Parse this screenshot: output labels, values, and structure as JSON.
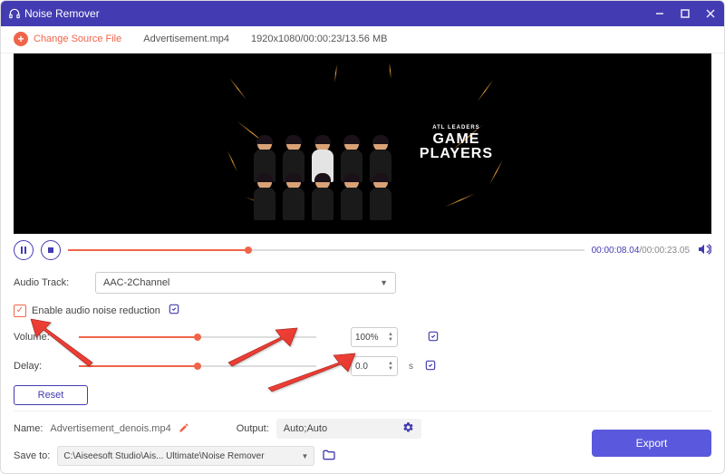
{
  "title": "Noise Remover",
  "toolbar": {
    "change_label": "Change Source File",
    "filename": "Advertisement.mp4",
    "info": "1920x1080/00:00:23/13.56 MB"
  },
  "preview": {
    "subtitle": "ATL LEADERS",
    "title1": "GAME",
    "title2": "PLAYERS"
  },
  "playbar": {
    "current": "00:00:08.04",
    "sep": "/",
    "total": "00:00:23.05",
    "progress_pct": 35
  },
  "settings": {
    "audio_track_label": "Audio Track:",
    "audio_track_value": "AAC-2Channel",
    "enable_noise": "Enable audio noise reduction",
    "volume_label": "Volume:",
    "volume_value": "100%",
    "volume_pct": 50,
    "delay_label": "Delay:",
    "delay_value": "0.0",
    "delay_pct": 50,
    "delay_unit": "s",
    "reset": "Reset"
  },
  "footer": {
    "name_label": "Name:",
    "name_value": "Advertisement_denois.mp4",
    "output_label": "Output:",
    "output_value": "Auto;Auto",
    "saveto_label": "Save to:",
    "saveto_value": "C:\\Aiseesoft Studio\\Ais... Ultimate\\Noise Remover",
    "export": "Export"
  }
}
